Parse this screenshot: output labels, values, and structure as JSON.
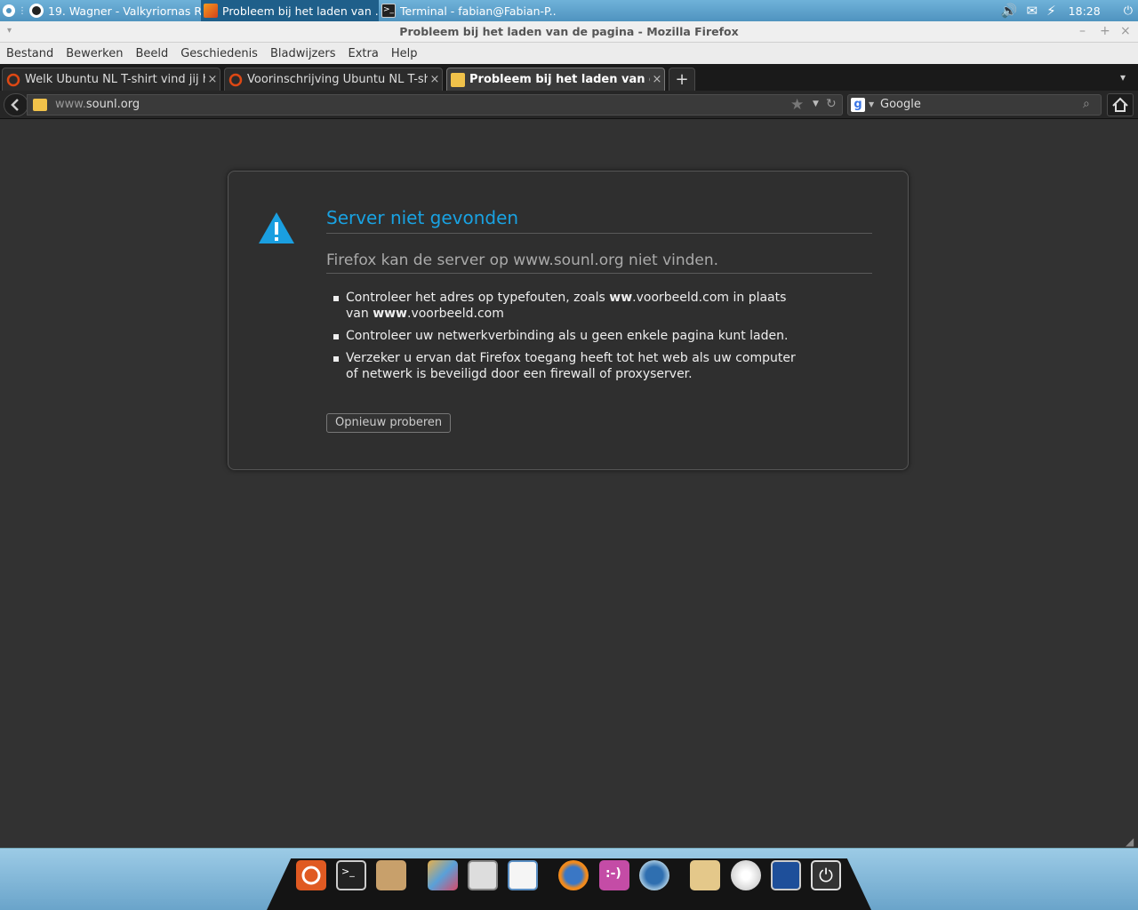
{
  "top_panel": {
    "tasks": [
      {
        "label": "19. Wagner - Valkyriornas R..."
      },
      {
        "label": "Probleem bij het laden van ..."
      },
      {
        "label": "Terminal - fabian@Fabian-P..."
      }
    ],
    "clock": "18:28"
  },
  "window": {
    "title": "Probleem bij het laden van de pagina - Mozilla Firefox"
  },
  "menu": [
    "Bestand",
    "Bewerken",
    "Beeld",
    "Geschiedenis",
    "Bladwijzers",
    "Extra",
    "Help"
  ],
  "tabs": [
    {
      "label": "Welk Ubuntu NL T-shirt vind jij h..."
    },
    {
      "label": "Voorinschrijving Ubuntu NL T-sh..."
    },
    {
      "label": "Probleem bij het laden van de..."
    }
  ],
  "nav": {
    "url_prefix": "www.",
    "url_domain": "sounl.org",
    "search_placeholder": "Google"
  },
  "error": {
    "title": "Server niet gevonden",
    "subtitle": "Firefox kan de server op www.sounl.org niet vinden.",
    "items": [
      {
        "a": "Controleer het adres op typefouten, zoals ",
        "b1": "ww",
        "c": ".voorbeeld.com in plaats van ",
        "b2": "www",
        "d": ".voorbeeld.com"
      },
      {
        "text": "Controleer uw netwerkverbinding als u geen enkele pagina kunt laden."
      },
      {
        "text": "Verzeker u ervan dat Firefox toegang heeft tot het web als uw computer of netwerk is beveiligd door een firewall of proxyserver."
      }
    ],
    "retry_label": "Opnieuw proberen"
  },
  "colors": {
    "accent_blue": "#19a2e2",
    "page_bg": "#323232",
    "panel_blue": "#5ea3cc"
  },
  "dock_icons": [
    "ubuntu-icon",
    "terminal-icon",
    "package-icon",
    "paint-icon",
    "calculator-icon",
    "writer-icon",
    "firefox-icon",
    "chat-icon",
    "thunderbird-icon",
    "folder-icon",
    "disc-icon",
    "display-icon",
    "power-icon"
  ]
}
